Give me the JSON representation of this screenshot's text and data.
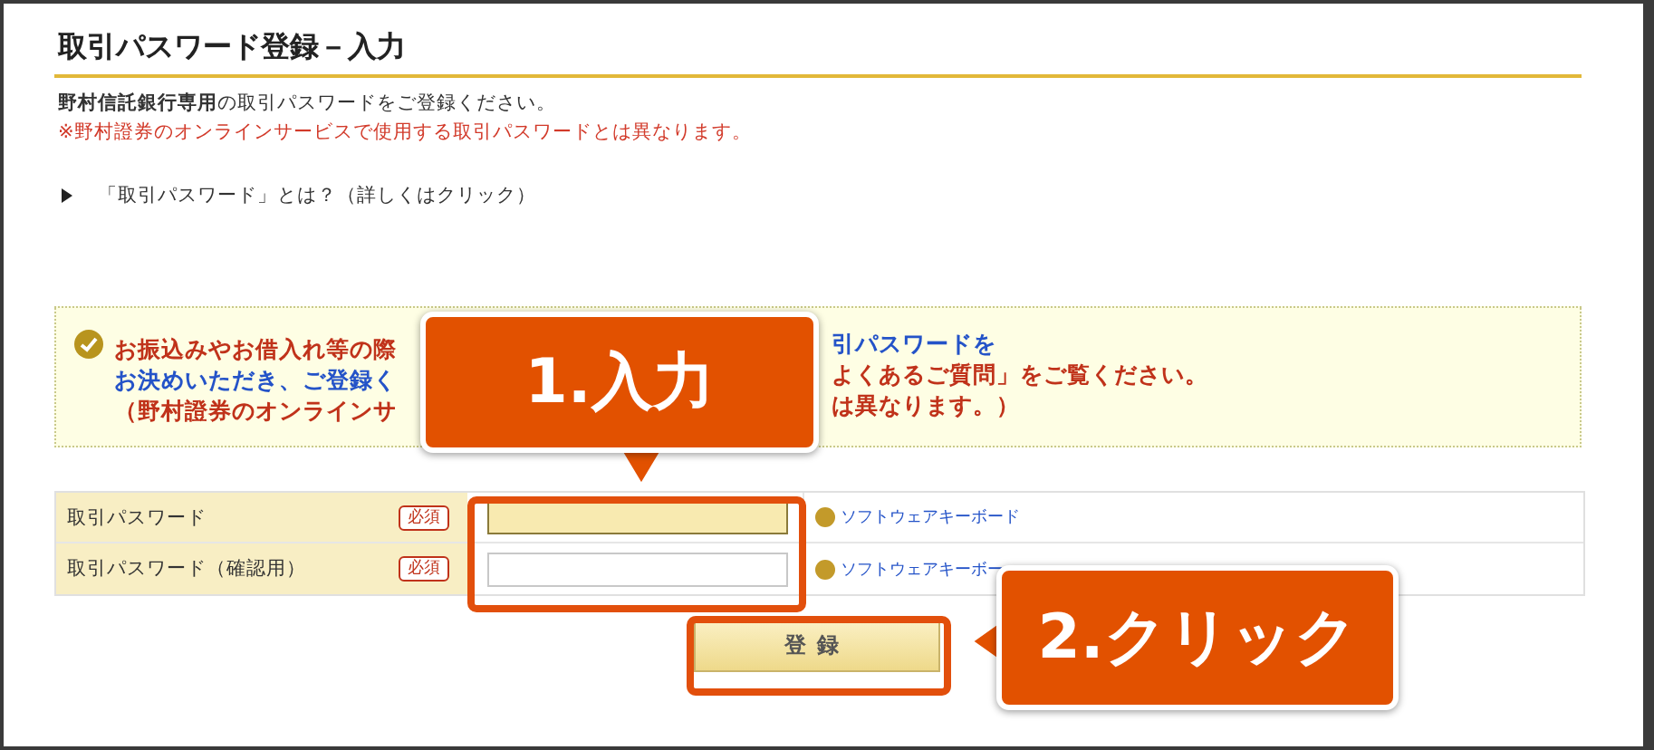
{
  "title": "取引パスワード登録－入力",
  "intro": "**野村信託銀行専用**の取引パスワードをご登録ください。",
  "note": "※野村證券のオンラインサービスで使用する取引パスワードとは異なります。",
  "help_link": "「取引パスワード」とは？（詳しくはクリック）",
  "notice": {
    "lines": [
      {
        "left": {
          "text": "お振込みやお借入れ等の際",
          "color": "#c0321a"
        },
        "right": {
          "text": "引パスワードを",
          "color": "#2453c8"
        }
      },
      {
        "left": {
          "text": "お決めいただき、ご登録く",
          "color": "#2453c8"
        },
        "right": {
          "text": "よくあるご質問」をご覧ください。",
          "color": "#c0321a"
        }
      },
      {
        "left": {
          "text": "（野村證券のオンラインサ",
          "color": "#c0321a"
        },
        "right": {
          "text": "は異なります。）",
          "color": "#c0321a"
        }
      }
    ]
  },
  "form": {
    "rows": [
      {
        "label": "取引パスワード",
        "required": "必須",
        "focused": true,
        "keyboard_link": "ソフトウェアキーボード"
      },
      {
        "label": "取引パスワード（確認用）",
        "required": "必須",
        "focused": false,
        "keyboard_link": "ソフトウェアキーボー"
      }
    ]
  },
  "submit": "登録",
  "callouts": [
    {
      "text": "1.入力",
      "kind": "down"
    },
    {
      "text": "2.クリック",
      "kind": "left"
    }
  ]
}
